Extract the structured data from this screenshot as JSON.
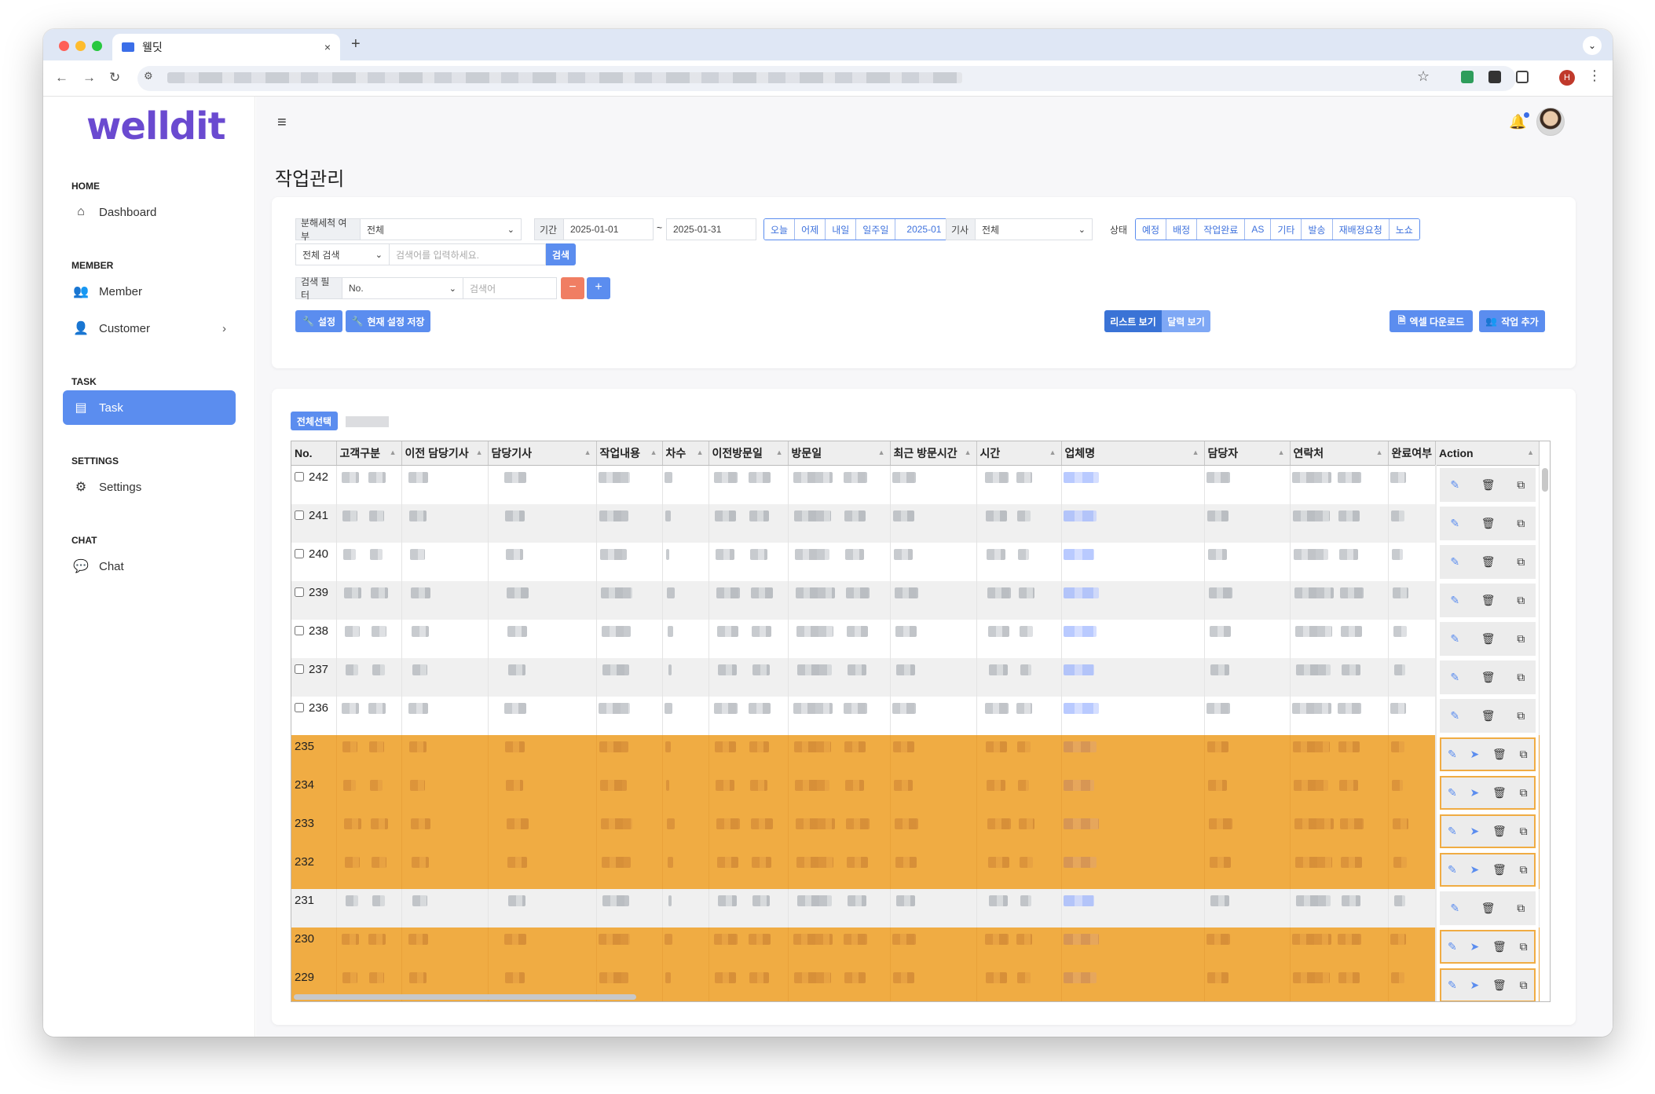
{
  "browser": {
    "tab_title": "웰딧",
    "new_tab_symbol": "+",
    "close_symbol": "×",
    "profile_initial": "H"
  },
  "sidebar": {
    "logo": "welldit",
    "sections": [
      {
        "title": "HOME",
        "items": [
          {
            "label": "Dashboard",
            "icon": "home-icon"
          }
        ]
      },
      {
        "title": "MEMBER",
        "items": [
          {
            "label": "Member",
            "icon": "users-icon"
          },
          {
            "label": "Customer",
            "icon": "customer-icon"
          }
        ]
      },
      {
        "title": "TASK",
        "items": [
          {
            "label": "Task",
            "icon": "task-icon",
            "active": true
          }
        ]
      },
      {
        "title": "SETTINGS",
        "items": [
          {
            "label": "Settings",
            "icon": "gear-icon"
          }
        ]
      },
      {
        "title": "CHAT",
        "items": [
          {
            "label": "Chat",
            "icon": "chat-icon"
          }
        ]
      }
    ]
  },
  "page": {
    "title": "작업관리"
  },
  "filters": {
    "installation_label": "분해세척 여부",
    "installation_value": "전체",
    "period_label": "기간",
    "date_from": "2025-01-01",
    "date_sep": "~",
    "date_to": "2025-01-31",
    "quick_dates": [
      "오늘",
      "어제",
      "내일",
      "일주일"
    ],
    "month_value": "2025-01",
    "technician_label": "기사",
    "technician_value": "전체",
    "status_label": "상태",
    "status_options": [
      "예정",
      "배정",
      "작업완료",
      "AS",
      "기타",
      "발송",
      "재배정요청",
      "노쇼"
    ],
    "search_scope": "전체 검색",
    "search_placeholder": "검색어를 입력하세요.",
    "search_button": "검색",
    "filter_label": "검색 필터",
    "filter_field": "No.",
    "filter_placeholder": "검색어",
    "remove_symbol": "−",
    "add_symbol": "+",
    "settings_button": "설정",
    "save_settings_button": "현재 설정 저장",
    "list_view": "리스트 보기",
    "calendar_view": "달력 보기",
    "excel_button": "엑셀 다운로드",
    "add_task_button": "작업 추가"
  },
  "table": {
    "select_all": "전체선택",
    "columns": [
      "No.",
      "고객구분",
      "이전 담당기사",
      "담당기사",
      "작업내용",
      "차수",
      "이전방문일",
      "방문일",
      "최근 방문시간",
      "시간",
      "업체명",
      "담당자",
      "연락처",
      "완료여부",
      "Action"
    ],
    "rows": [
      {
        "no": "242",
        "checkbox": true,
        "highlight": "white",
        "send": false
      },
      {
        "no": "241",
        "checkbox": true,
        "highlight": "gray",
        "send": false
      },
      {
        "no": "240",
        "checkbox": true,
        "highlight": "white",
        "send": false
      },
      {
        "no": "239",
        "checkbox": true,
        "highlight": "gray",
        "send": false
      },
      {
        "no": "238",
        "checkbox": true,
        "highlight": "white",
        "send": false
      },
      {
        "no": "237",
        "checkbox": true,
        "highlight": "gray",
        "send": false
      },
      {
        "no": "236",
        "checkbox": true,
        "highlight": "white",
        "send": false
      },
      {
        "no": "235",
        "checkbox": false,
        "highlight": "orange",
        "send": true
      },
      {
        "no": "234",
        "checkbox": false,
        "highlight": "orange",
        "send": true
      },
      {
        "no": "233",
        "checkbox": false,
        "highlight": "orange",
        "send": true
      },
      {
        "no": "232",
        "checkbox": false,
        "highlight": "orange",
        "send": true
      },
      {
        "no": "231",
        "checkbox": false,
        "highlight": "gray",
        "send": false
      },
      {
        "no": "230",
        "checkbox": false,
        "highlight": "orange",
        "send": true
      },
      {
        "no": "229",
        "checkbox": false,
        "highlight": "orange",
        "send": true
      }
    ]
  },
  "colors": {
    "primary": "#5b8def",
    "highlight": "#f0ac43",
    "logo": "#6a4ad0"
  }
}
